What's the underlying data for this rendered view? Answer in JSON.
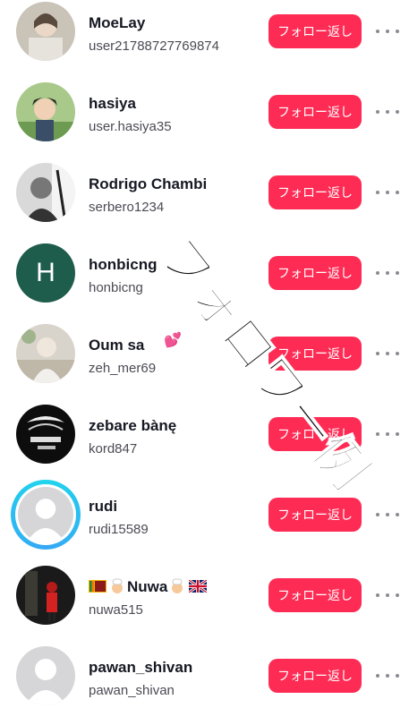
{
  "colors": {
    "follow_button": "#fe2c55",
    "ring": "#20d5ec"
  },
  "follow_label": "フォロー返し",
  "overlay_text": "フォロワー例",
  "users": [
    {
      "name": "MoeLay",
      "handle": "user21788727769874",
      "avatar": "photo-avatar-1"
    },
    {
      "name": "hasiya",
      "handle": "user.hasiya35",
      "avatar": "anime-avatar"
    },
    {
      "name": "Rodrigo Chambi",
      "handle": "serbero1234",
      "avatar": "photo-avatar-bw"
    },
    {
      "name": "honbicng",
      "handle": "honbicng",
      "avatar_letter": "H"
    },
    {
      "name": "Oum sa",
      "handle": "zeh_mer69",
      "avatar": "photo-avatar-girl"
    },
    {
      "name": "zebare bànę",
      "handle": "kord847",
      "avatar": "logo-avatar"
    },
    {
      "name": "rudi",
      "handle": "rudi15589",
      "avatar": "default-avatar"
    },
    {
      "name": "Nuwa",
      "handle": "nuwa515",
      "avatar": "photo-avatar-red"
    },
    {
      "name": "pawan_shivan",
      "handle": "pawan_shivan",
      "avatar": "default-avatar"
    }
  ]
}
